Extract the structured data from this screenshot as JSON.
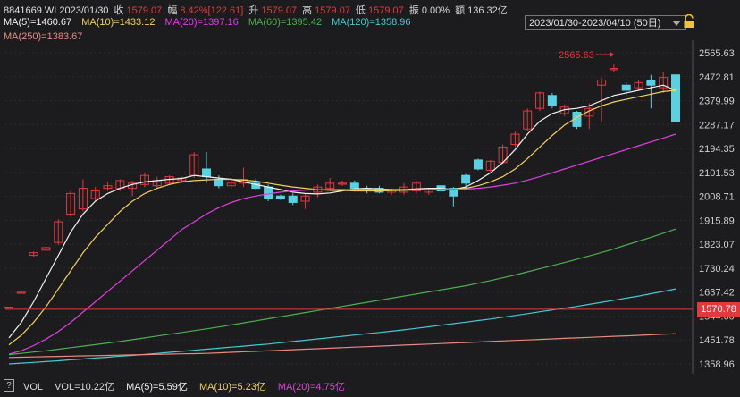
{
  "header": {
    "code_date": "8841669.WI 2023/01/30",
    "close_label": "收",
    "close_value": "1579.07",
    "amp_label": "幅",
    "amp_value": "8.42%[122.61]",
    "up_label": "升",
    "up_value": "1579.07",
    "high_label": "高",
    "high_value": "1579.07",
    "low_label": "低",
    "low_value": "1579.07",
    "zhen_label": "振",
    "zhen_value": "0.00%",
    "amount_label": "额",
    "amount_value": "136.32亿",
    "range": "2023/01/30-2023/04/10 (50日)",
    "ma": [
      {
        "text": "MA(5)=1460.67",
        "color": "#f2f2f2"
      },
      {
        "text": "MA(10)=1433.12",
        "color": "#f0d060"
      },
      {
        "text": "MA(20)=1397.16",
        "color": "#e040e0"
      },
      {
        "text": "MA(60)=1395.42",
        "color": "#4caf50"
      },
      {
        "text": "MA(120)=1358.96",
        "color": "#46c8d0"
      }
    ],
    "ma250": {
      "text": "MA(250)=1383.67",
      "color": "#e88a80"
    }
  },
  "footer": {
    "help": "?",
    "vol_label": "VOL",
    "vol_value": "VOL=10.22亿",
    "vol_ma5": "MA(5)=5.59亿",
    "vol_ma10": "MA(10)=5.23亿",
    "vol_ma20": "MA(20)=4.75亿",
    "colors": {
      "ma5": "#f2f2f2",
      "ma10": "#f0d060",
      "ma20": "#e040e0"
    }
  },
  "chart_data": {
    "type": "candlestick",
    "y_ticks": [
      "2565.63",
      "2472.81",
      "2379.99",
      "2287.17",
      "2194.35",
      "2101.53",
      "2008.71",
      "1915.89",
      "1823.07",
      "1730.24",
      "1637.42",
      "1544.60",
      "1451.78",
      "1358.96"
    ],
    "ylim": [
      1358.96,
      2565.63
    ],
    "current_price": "1570.78",
    "max_label": "2565.63",
    "candles": [
      {
        "o": 1579.07,
        "c": 1579.07,
        "h": 1579.07,
        "l": 1579.07
      },
      {
        "o": 1637,
        "c": 1637,
        "h": 1637,
        "l": 1637
      },
      {
        "o": 1780,
        "c": 1790,
        "h": 1795,
        "l": 1775
      },
      {
        "o": 1800,
        "c": 1810,
        "h": 1815,
        "l": 1795
      },
      {
        "o": 1830,
        "c": 1910,
        "h": 1920,
        "l": 1820
      },
      {
        "o": 1940,
        "c": 2020,
        "h": 2030,
        "l": 1930
      },
      {
        "o": 1960,
        "c": 2040,
        "h": 2075,
        "l": 1950
      },
      {
        "o": 2000,
        "c": 2030,
        "h": 2045,
        "l": 1990
      },
      {
        "o": 2040,
        "c": 2050,
        "h": 2065,
        "l": 2030
      },
      {
        "o": 2040,
        "c": 2070,
        "h": 2075,
        "l": 2030
      },
      {
        "o": 2040,
        "c": 2060,
        "h": 2070,
        "l": 2010
      },
      {
        "o": 2055,
        "c": 2090,
        "h": 2100,
        "l": 2045
      },
      {
        "o": 2050,
        "c": 2070,
        "h": 2085,
        "l": 2040
      },
      {
        "o": 2060,
        "c": 2085,
        "h": 2090,
        "l": 2055
      },
      {
        "o": 2070,
        "c": 2080,
        "h": 2085,
        "l": 2060
      },
      {
        "o": 2090,
        "c": 2170,
        "h": 2180,
        "l": 2080
      },
      {
        "o": 2115,
        "c": 2085,
        "h": 2180,
        "l": 2060
      },
      {
        "o": 2075,
        "c": 2050,
        "h": 2090,
        "l": 2040
      },
      {
        "o": 2050,
        "c": 2060,
        "h": 2080,
        "l": 2040
      },
      {
        "o": 2060,
        "c": 2075,
        "h": 2120,
        "l": 2045
      },
      {
        "o": 2060,
        "c": 2040,
        "h": 2080,
        "l": 2030
      },
      {
        "o": 2045,
        "c": 2000,
        "h": 2055,
        "l": 1990
      },
      {
        "o": 2010,
        "c": 2000,
        "h": 2015,
        "l": 1995
      },
      {
        "o": 2010,
        "c": 1985,
        "h": 2020,
        "l": 1975
      },
      {
        "o": 1990,
        "c": 2010,
        "h": 2020,
        "l": 1960
      },
      {
        "o": 2025,
        "c": 2045,
        "h": 2055,
        "l": 2005
      },
      {
        "o": 2040,
        "c": 2060,
        "h": 2080,
        "l": 2030
      },
      {
        "o": 2060,
        "c": 2060,
        "h": 2070,
        "l": 2050
      },
      {
        "o": 2060,
        "c": 2040,
        "h": 2070,
        "l": 2030
      },
      {
        "o": 2040,
        "c": 2030,
        "h": 2050,
        "l": 2020
      },
      {
        "o": 2040,
        "c": 2025,
        "h": 2050,
        "l": 2020
      },
      {
        "o": 2025,
        "c": 2035,
        "h": 2040,
        "l": 2015
      },
      {
        "o": 2025,
        "c": 2045,
        "h": 2060,
        "l": 2015
      },
      {
        "o": 2030,
        "c": 2060,
        "h": 2070,
        "l": 2020
      },
      {
        "o": 2025,
        "c": 2035,
        "h": 2040,
        "l": 2015
      },
      {
        "o": 2050,
        "c": 2030,
        "h": 2060,
        "l": 2020
      },
      {
        "o": 2040,
        "c": 2010,
        "h": 2045,
        "l": 1970
      },
      {
        "o": 2090,
        "c": 2060,
        "h": 2095,
        "l": 2040
      },
      {
        "o": 2150,
        "c": 2115,
        "h": 2155,
        "l": 2110
      },
      {
        "o": 2110,
        "c": 2145,
        "h": 2150,
        "l": 2105
      },
      {
        "o": 2140,
        "c": 2200,
        "h": 2210,
        "l": 2135
      },
      {
        "o": 2210,
        "c": 2250,
        "h": 2260,
        "l": 2200
      },
      {
        "o": 2270,
        "c": 2340,
        "h": 2350,
        "l": 2260
      },
      {
        "o": 2350,
        "c": 2410,
        "h": 2415,
        "l": 2340
      },
      {
        "o": 2400,
        "c": 2360,
        "h": 2410,
        "l": 2350
      },
      {
        "o": 2330,
        "c": 2355,
        "h": 2365,
        "l": 2320
      },
      {
        "o": 2335,
        "c": 2280,
        "h": 2340,
        "l": 2270
      },
      {
        "o": 2320,
        "c": 2350,
        "h": 2370,
        "l": 2270
      },
      {
        "o": 2440,
        "c": 2460,
        "h": 2470,
        "l": 2300
      },
      {
        "o": 2500,
        "c": 2505,
        "h": 2520,
        "l": 2490
      },
      {
        "o": 2440,
        "c": 2420,
        "h": 2450,
        "l": 2400
      },
      {
        "o": 2430,
        "c": 2450,
        "h": 2460,
        "l": 2420
      },
      {
        "o": 2460,
        "c": 2440,
        "h": 2480,
        "l": 2350
      },
      {
        "o": 2430,
        "c": 2470,
        "h": 2490,
        "l": 2410
      },
      {
        "o": 2480,
        "c": 2300,
        "h": 2480,
        "l": 2300
      }
    ],
    "series": [
      {
        "name": "MA(5)",
        "color": "#f2f2f2",
        "values": [
          1460,
          1520,
          1600,
          1690,
          1780,
          1870,
          1940,
          1990,
          2020,
          2040,
          2055,
          2065,
          2070,
          2075,
          2078,
          2090,
          2085,
          2080,
          2075,
          2065,
          2055,
          2045,
          2035,
          2025,
          2020,
          2018,
          2022,
          2030,
          2038,
          2040,
          2038,
          2035,
          2035,
          2038,
          2040,
          2040,
          2035,
          2045,
          2070,
          2100,
          2140,
          2190,
          2250,
          2300,
          2330,
          2345,
          2350,
          2360,
          2380,
          2400,
          2410,
          2420,
          2430,
          2440,
          2420
        ]
      },
      {
        "name": "MA(10)",
        "color": "#f0d060",
        "values": [
          1433,
          1470,
          1520,
          1580,
          1650,
          1720,
          1790,
          1850,
          1900,
          1950,
          1990,
          2020,
          2040,
          2055,
          2065,
          2070,
          2073,
          2075,
          2075,
          2072,
          2068,
          2060,
          2052,
          2045,
          2040,
          2035,
          2032,
          2032,
          2030,
          2030,
          2030,
          2031,
          2032,
          2034,
          2036,
          2037,
          2036,
          2040,
          2050,
          2065,
          2085,
          2115,
          2155,
          2200,
          2245,
          2285,
          2315,
          2340,
          2360,
          2375,
          2385,
          2395,
          2405,
          2415,
          2420
        ]
      },
      {
        "name": "MA(20)",
        "color": "#e040e0",
        "values": [
          1397,
          1410,
          1430,
          1455,
          1485,
          1520,
          1560,
          1600,
          1640,
          1680,
          1720,
          1760,
          1800,
          1840,
          1880,
          1910,
          1940,
          1965,
          1985,
          2000,
          2010,
          2018,
          2025,
          2030,
          2033,
          2035,
          2036,
          2036,
          2035,
          2035,
          2034,
          2034,
          2034,
          2034,
          2035,
          2036,
          2036,
          2037,
          2040,
          2045,
          2052,
          2060,
          2072,
          2085,
          2100,
          2115,
          2130,
          2145,
          2160,
          2175,
          2190,
          2205,
          2220,
          2235,
          2250
        ]
      },
      {
        "name": "MA(60)",
        "color": "#4caf50",
        "values": [
          1395,
          1400,
          1405,
          1410,
          1416,
          1422,
          1428,
          1434,
          1440,
          1446,
          1453,
          1460,
          1467,
          1474,
          1481,
          1488,
          1495,
          1502,
          1510,
          1518,
          1526,
          1534,
          1542,
          1550,
          1558,
          1566,
          1574,
          1582,
          1590,
          1598,
          1606,
          1614,
          1622,
          1630,
          1638,
          1646,
          1654,
          1662,
          1672,
          1682,
          1693,
          1704,
          1716,
          1728,
          1740,
          1752,
          1765,
          1778,
          1791,
          1805,
          1820,
          1835,
          1850,
          1866,
          1882
        ]
      },
      {
        "name": "MA(120)",
        "color": "#46c8d0",
        "values": [
          1359,
          1362,
          1365,
          1368,
          1371,
          1375,
          1378,
          1382,
          1385,
          1389,
          1392,
          1396,
          1400,
          1404,
          1408,
          1412,
          1416,
          1420,
          1424,
          1428,
          1432,
          1436,
          1441,
          1446,
          1451,
          1456,
          1461,
          1466,
          1471,
          1476,
          1481,
          1486,
          1491,
          1497,
          1503,
          1509,
          1515,
          1521,
          1527,
          1533,
          1540,
          1547,
          1554,
          1561,
          1568,
          1575,
          1582,
          1590,
          1598,
          1606,
          1614,
          1622,
          1631,
          1640,
          1650
        ]
      },
      {
        "name": "MA(250)",
        "color": "#e88a80",
        "values": [
          1384,
          1385,
          1386,
          1387,
          1388,
          1389,
          1390,
          1391,
          1392,
          1393,
          1394,
          1395,
          1396,
          1397,
          1398,
          1399,
          1400,
          1402,
          1404,
          1406,
          1408,
          1410,
          1412,
          1414,
          1416,
          1418,
          1420,
          1422,
          1424,
          1426,
          1428,
          1430,
          1432,
          1434,
          1436,
          1438,
          1440,
          1442,
          1444,
          1446,
          1448,
          1450,
          1452,
          1454,
          1456,
          1458,
          1460,
          1462,
          1464,
          1466,
          1468,
          1470,
          1472,
          1474,
          1476
        ]
      }
    ],
    "up_color": "#e03a3e",
    "down_color": "#5ad0e0"
  }
}
